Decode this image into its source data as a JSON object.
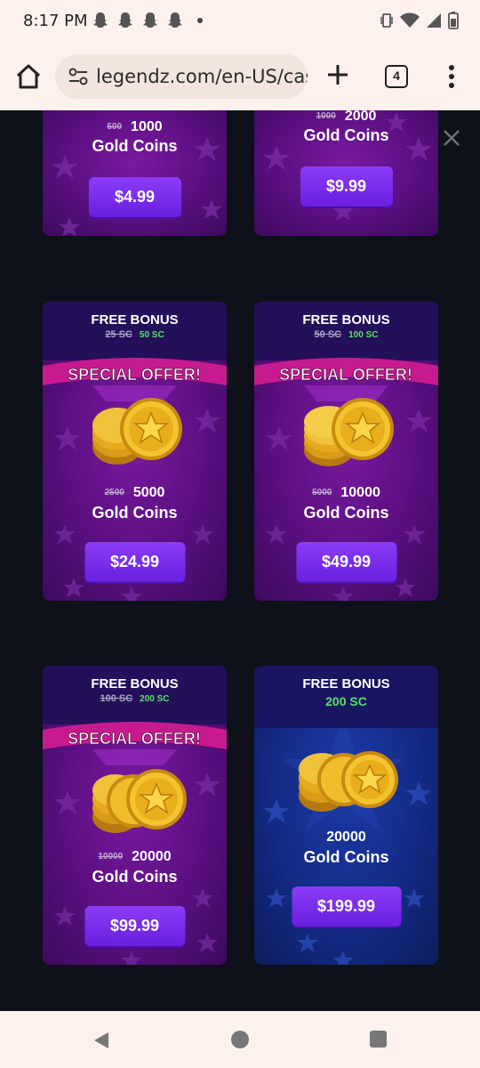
{
  "status_bar": {
    "time": "8:17 PM",
    "left_icons": [
      "snapchat-icon",
      "snapchat-icon",
      "snapchat-icon",
      "snapchat-icon",
      "dot-icon"
    ],
    "right_icons": [
      "vibrate-icon",
      "wifi-icon",
      "signal-icon",
      "battery-icon"
    ]
  },
  "browser": {
    "url": "legendz.com/en-US/casi",
    "tab_count": "4",
    "icons": [
      "home-icon",
      "tune-icon",
      "plus-icon",
      "more-vert-icon"
    ]
  },
  "page": {
    "close_icon": "close-icon",
    "packages": [
      {
        "old_amount": "500",
        "amount": "1000",
        "label": "Gold Coins",
        "price": "$4.99"
      },
      {
        "old_amount": "1000",
        "amount": "2000",
        "label": "Gold Coins",
        "price": "$9.99"
      },
      {
        "bonus_title": "FREE BONUS",
        "bonus_old": "25 SC",
        "bonus_new": "50 SC",
        "banner": "SPECIAL OFFER!",
        "old_amount": "2500",
        "amount": "5000",
        "label": "Gold Coins",
        "price": "$24.99"
      },
      {
        "bonus_title": "FREE BONUS",
        "bonus_old": "50 SC",
        "bonus_new": "100 SC",
        "banner": "SPECIAL OFFER!",
        "old_amount": "5000",
        "amount": "10000",
        "label": "Gold Coins",
        "price": "$49.99"
      },
      {
        "bonus_title": "FREE BONUS",
        "bonus_old": "100 SC",
        "bonus_new": "200 SC",
        "banner": "SPECIAL OFFER!",
        "old_amount": "10000",
        "amount": "20000",
        "label": "Gold Coins",
        "price": "$99.99"
      },
      {
        "bonus_title": "FREE BONUS",
        "bonus_new": "200 SC",
        "amount": "20000",
        "label": "Gold Coins",
        "price": "$199.99"
      }
    ]
  },
  "nav_bar": {
    "icons": [
      "back-icon",
      "home-circle-icon",
      "recents-icon"
    ]
  },
  "colors": {
    "purple_card": "#5a0f80",
    "blue_card": "#142b86",
    "button": "#7a2ef0",
    "bonus_green": "#57e06a",
    "background": "#0e1119"
  }
}
